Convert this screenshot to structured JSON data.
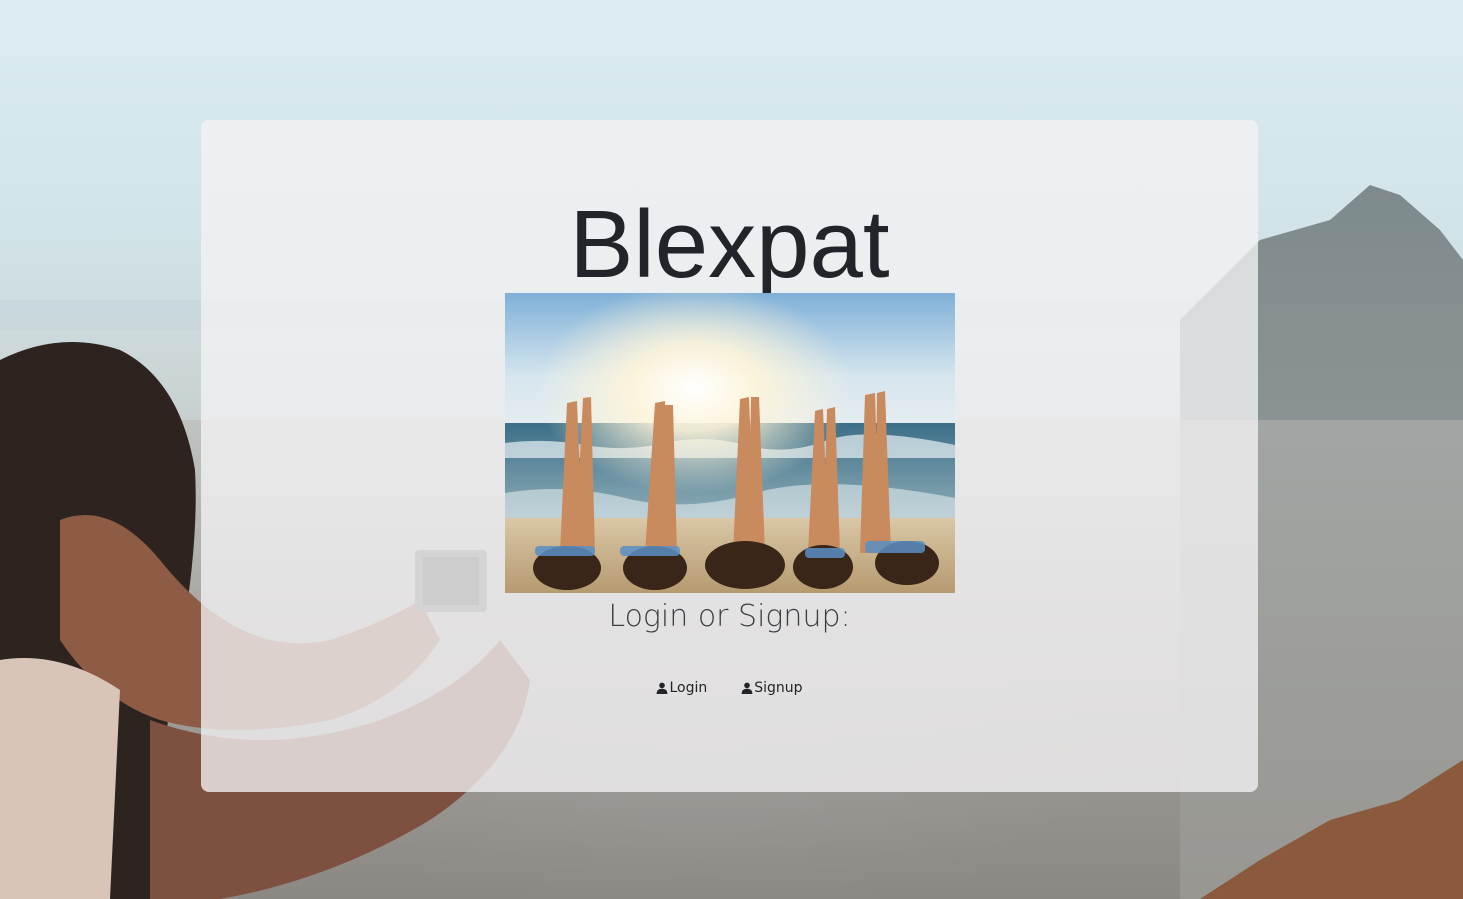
{
  "brand": {
    "title": "Blexpat"
  },
  "hero": {
    "alt": ""
  },
  "auth": {
    "prompt": "Login or Signup:",
    "login_label": "Login",
    "signup_label": "Signup"
  },
  "icons": {
    "login_icon": "user-icon",
    "signup_icon": "user-icon"
  },
  "colors": {
    "text": "#212529",
    "card_bg": "#f4f2f4"
  }
}
